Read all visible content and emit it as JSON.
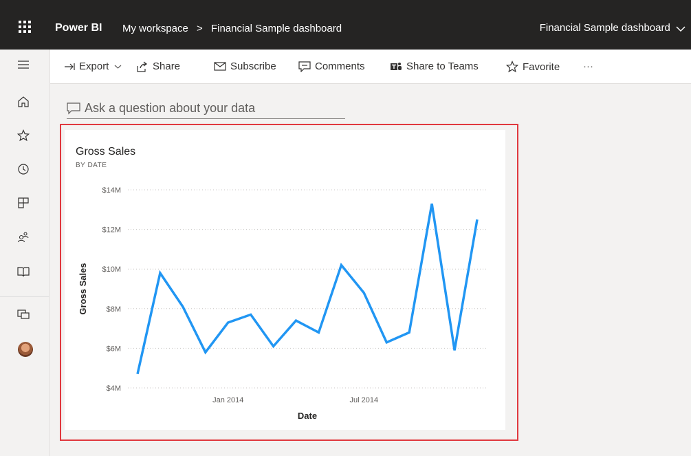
{
  "header": {
    "brand": "Power BI",
    "breadcrumb_workspace": "My workspace",
    "breadcrumb_separator": ">",
    "breadcrumb_dashboard": "Financial Sample dashboard",
    "title_right": "Financial Sample dashboard"
  },
  "toolbar": {
    "export": "Export",
    "share": "Share",
    "subscribe": "Subscribe",
    "comments": "Comments",
    "share_teams": "Share to Teams",
    "favorite": "Favorite",
    "more": "···"
  },
  "qna": {
    "placeholder": "Ask a question about your data"
  },
  "nav": {
    "icons": [
      "menu-icon",
      "home-icon",
      "star-icon",
      "clock-icon",
      "apps-icon",
      "shared-icon",
      "learn-icon",
      "workspaces-icon"
    ]
  },
  "tile": {
    "title": "Gross Sales",
    "subtitle": "BY DATE"
  },
  "colors": {
    "line": "#2196f3",
    "highlight": "#e0383e",
    "topbar": "#252423"
  },
  "chart_data": {
    "type": "line",
    "title": "Gross Sales",
    "subtitle": "BY DATE",
    "xlabel": "Date",
    "ylabel": "Gross Sales",
    "y_ticks": [
      "$4M",
      "$6M",
      "$8M",
      "$10M",
      "$12M",
      "$14M"
    ],
    "ylim": [
      4,
      14
    ],
    "x_ticks": [
      "Jan 2014",
      "Jul 2014"
    ],
    "x_range": [
      "2013-09",
      "2014-12"
    ],
    "grid": true,
    "series": [
      {
        "x": [
          "2013-09",
          "2013-10",
          "2013-11",
          "2013-12",
          "2014-01",
          "2014-02",
          "2014-03",
          "2014-04",
          "2014-05",
          "2014-06",
          "2014-07",
          "2014-08",
          "2014-09",
          "2014-10",
          "2014-11",
          "2014-12"
        ],
        "values": [
          4.7,
          9.8,
          8.1,
          5.8,
          7.3,
          7.7,
          6.1,
          7.4,
          6.8,
          10.2,
          8.8,
          6.3,
          6.8,
          13.3,
          5.9,
          12.5
        ]
      }
    ]
  }
}
